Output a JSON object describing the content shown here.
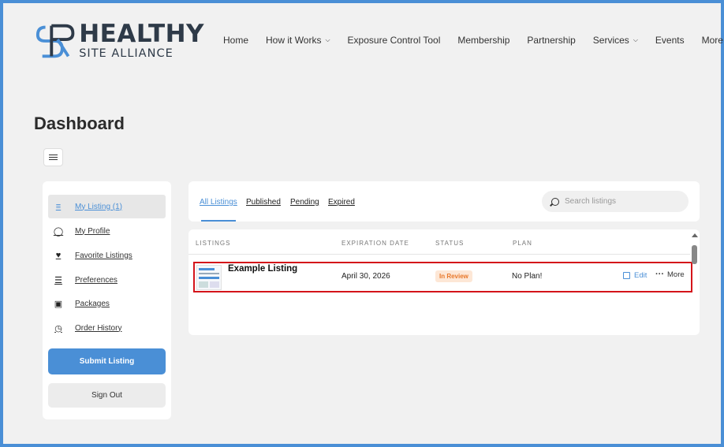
{
  "brand": {
    "logo_line1": "HEALTHY",
    "logo_line2": "SITE ALLIANCE",
    "logo_color": "#2e3a48",
    "accent_color": "#4a8fd6"
  },
  "nav": {
    "items": [
      {
        "label": "Home",
        "has_dropdown": false
      },
      {
        "label": "How it Works",
        "has_dropdown": true
      },
      {
        "label": "Exposure Control Tool",
        "has_dropdown": false
      },
      {
        "label": "Membership",
        "has_dropdown": false
      },
      {
        "label": "Partnership",
        "has_dropdown": false
      },
      {
        "label": "Services",
        "has_dropdown": true
      },
      {
        "label": "Events",
        "has_dropdown": false
      },
      {
        "label": "More",
        "has_dropdown": true
      }
    ]
  },
  "page": {
    "title": "Dashboard",
    "menu_toggle_icon": "hamburger-icon"
  },
  "sidebar": {
    "items": [
      {
        "label": "My Listing (1)",
        "icon": "list-icon",
        "active": true
      },
      {
        "label": "My Profile",
        "icon": "user-icon",
        "active": false
      },
      {
        "label": "Favorite Listings",
        "icon": "heart-icon",
        "active": false
      },
      {
        "label": "Preferences",
        "icon": "sliders-icon",
        "active": false
      },
      {
        "label": "Packages",
        "icon": "money-icon",
        "active": false
      },
      {
        "label": "Order History",
        "icon": "clock-icon",
        "active": false
      }
    ],
    "submit_label": "Submit Listing",
    "signout_label": "Sign Out"
  },
  "tabs": {
    "items": [
      {
        "label": "All Listings",
        "active": true
      },
      {
        "label": "Published",
        "active": false
      },
      {
        "label": "Pending",
        "active": false
      },
      {
        "label": "Expired",
        "active": false
      }
    ],
    "search_placeholder": "Search listings"
  },
  "table": {
    "columns": [
      "LISTINGS",
      "EXPIRATION DATE",
      "STATUS",
      "PLAN"
    ],
    "rows": [
      {
        "title": "Example Listing",
        "expiration": "April 30, 2026",
        "status": "In Review",
        "status_color": "#e8782a",
        "plan": "No Plan!",
        "edit_label": "Edit",
        "more_label": "More"
      }
    ]
  }
}
